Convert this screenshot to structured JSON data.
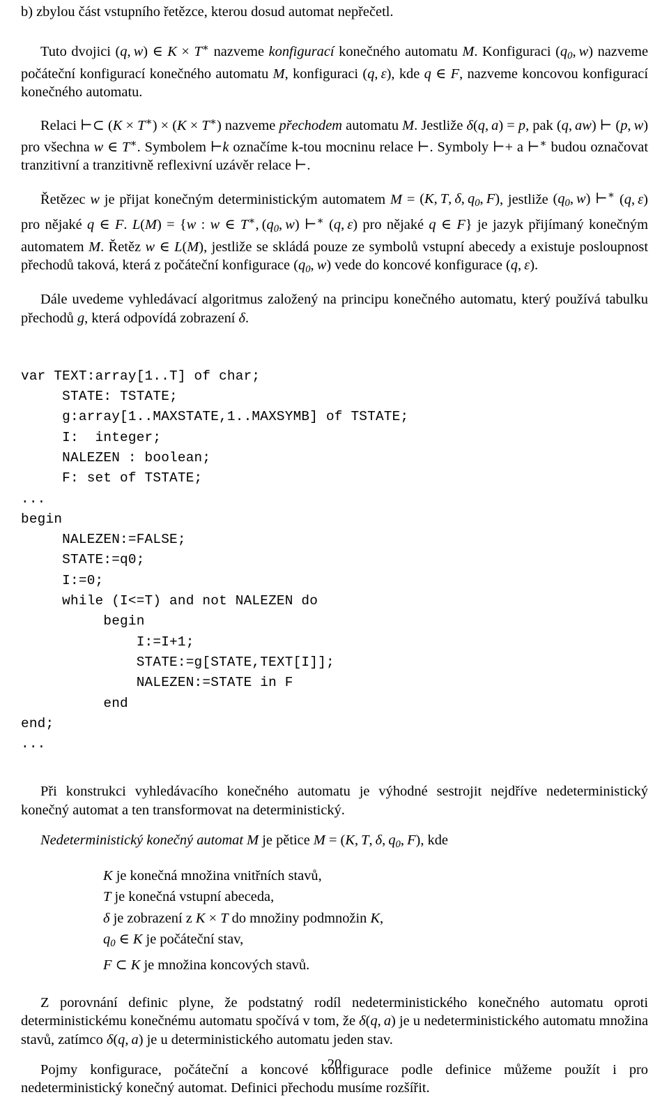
{
  "document": {
    "language": "cs",
    "page_number": "20",
    "blocks": {
      "item_b": "b) zbylou část vstupního řetězce, kterou dosud automat nepřečetl.",
      "para_konfigurace_1": "Tuto dvojici (q, w) ∈ K × T* nazveme konfigurací konečného automatu M. Konfiguraci",
      "para_konfigurace_2": "(q0, w) nazveme počáteční konfigurací konečného automatu M, konfiguraci (q, ε), kde q ∈ F,",
      "para_konfigurace_3": "nazveme koncovou konfigurací konečného automatu.",
      "para_relaci_1": "Relaci ⊢⊂ (K × T*) × (K × T*) nazveme přechodem automatu M. Jestliže δ(q, a) = p, pak",
      "para_relaci_2": "(q, aw) ⊢ (p, w) pro všechna w ∈ T*. Symbolem ⊢k označíme k-tou mocninu relace ⊢. Symboly",
      "para_relaci_3": "⊢+ a ⊢* budou označovat tranzitivní a tranzitivně reflexivní uzávěr relace ⊢.",
      "para_retezec_1": "Řetězec w je přijat konečným deterministickým automatem M = (K, T, δ, q0, F), jestliže",
      "para_retezec_2": "(q0, w) ⊢* (q, ε) pro nějaké q ∈ F. L(M) = {w : w ∈ T*, (q0, w) ⊢* (q, ε) pro nějaké q ∈ F} je",
      "para_retezec_3": "jazyk přijímaný konečným automatem M. Řetěz w ∈ L(M), jestliže se skládá pouze ze symbolů",
      "para_retezec_4": "vstupní abecedy a existuje posloupnost přechodů taková, která z počáteční konfigurace (q0, w)",
      "para_retezec_5": "vede do koncové konfigurace (q, ε).",
      "para_dale_1": "Dále uvedeme vyhledávací algoritmus založený na principu konečného automatu, který",
      "para_dale_2": "používá tabulku přechodů g, která odpovídá zobrazení δ.",
      "para_pri_konstrukci": "Při konstrukci vyhledávacího konečného automatu je výhodné sestrojit nejdříve nedeterministický konečný automat a ten transformovat na deterministický.",
      "para_nedeterministicky_def": "Nedeterministický konečný automat M je pětice M = (K, T, δ, q0, F), kde",
      "para_z_porovnani": "Z porovnání definic plyne, že podstatný rodíl nedeterministického konečného automatu oproti deterministickému konečnému automatu spočívá v tom, že δ(q, a) je u nedeterministického automatu množina stavů, zatímco δ(q, a) je u deterministického automatu jeden stav.",
      "para_pojmy": "Pojmy konfigurace, počáteční a koncové konfigurace podle definice můžeme použít i pro nedeterministický konečný automat. Definici přechodu musíme rozšířit."
    },
    "definition_list": [
      "K je konečná množina vnitřních stavů,",
      "T je konečná vstupní abeceda,",
      "δ je zobrazení z K × T do množiny podmnožin K,",
      "q0 ∈ K je počáteční stav,",
      "F ⊂ K je množina koncových stavů."
    ],
    "code_listing": "var TEXT:array[1..T] of char;\n     STATE: TSTATE;\n     g:array[1..MAXSTATE,1..MAXSYMB] of TSTATE;\n     I:  integer;\n     NALEZEN : boolean;\n     F: set of TSTATE;\n...\nbegin\n     NALEZEN:=FALSE;\n     STATE:=q0;\n     I:=0;\n     while (I<=T) and not NALEZEN do\n          begin\n              I:=I+1;\n              STATE:=g[STATE,TEXT[I]];\n              NALEZEN:=STATE in F\n          end\nend;\n..."
  }
}
